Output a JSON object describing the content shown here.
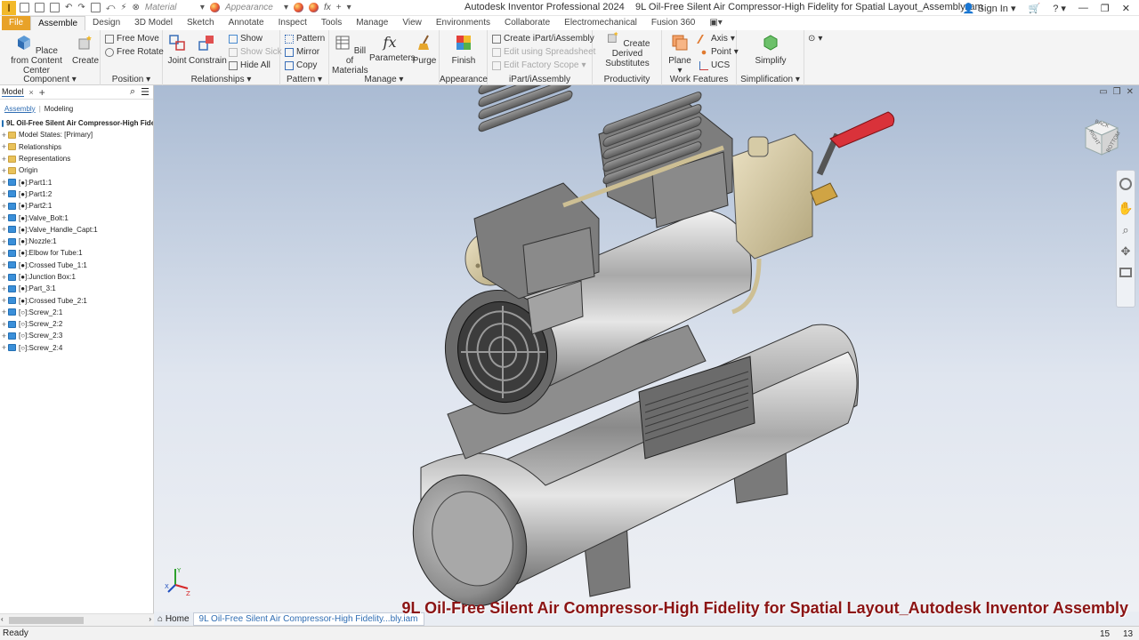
{
  "window": {
    "app_name": "Autodesk Inventor Professional 2024",
    "document_title": "9L Oil-Free Silent Air Compressor-High Fidelity for Spatial Layout_Assembly.iam",
    "sign_in": "Sign In",
    "material_label": "Material",
    "appearance_label": "Appearance"
  },
  "tabs": [
    "File",
    "Assemble",
    "Design",
    "3D Model",
    "Sketch",
    "Annotate",
    "Inspect",
    "Tools",
    "Manage",
    "View",
    "Environments",
    "Collaborate",
    "Electromechanical",
    "Fusion 360"
  ],
  "active_tab": "Assemble",
  "ribbon": {
    "component": {
      "title": "Component",
      "place": "Place from Content Center",
      "create": "Create"
    },
    "position": {
      "title": "Position",
      "free_move": "Free Move",
      "free_rotate": "Free Rotate"
    },
    "relationships": {
      "title": "Relationships",
      "joint": "Joint",
      "constrain": "Constrain",
      "show": "Show",
      "show_sick": "Show Sick",
      "hide_all": "Hide All"
    },
    "pattern": {
      "title": "Pattern",
      "pattern": "Pattern",
      "mirror": "Mirror",
      "copy": "Copy"
    },
    "manage": {
      "title": "Manage",
      "bom": "Bill of Materials",
      "parameters": "Parameters",
      "purge": "Purge"
    },
    "appearance": {
      "title": "Appearance",
      "finish": "Finish"
    },
    "ipart": {
      "title": "iPart/iAssembly",
      "create": "Create iPart/iAssembly",
      "edit_spreadsheet": "Edit using Spreadsheet",
      "edit_scope": "Edit Factory Scope"
    },
    "productivity": {
      "title": "Productivity",
      "derived": "Create Derived Substitutes"
    },
    "work_features": {
      "title": "Work Features",
      "plane": "Plane",
      "axis": "Axis",
      "point": "Point",
      "ucs": "UCS"
    },
    "simplification": {
      "title": "Simplification",
      "simplify": "Simplify"
    }
  },
  "browser": {
    "panel_tab": "Model",
    "sub_tabs": [
      "Assembly",
      "Modeling"
    ],
    "items": [
      {
        "label": "9L Oil-Free Silent Air Compressor-High Fide",
        "kind": "root"
      },
      {
        "label": "Model States: [Primary]",
        "kind": "folder"
      },
      {
        "label": "Relationships",
        "kind": "folder"
      },
      {
        "label": "Representations",
        "kind": "folder"
      },
      {
        "label": "Origin",
        "kind": "folder"
      },
      {
        "label": "[●]:Part1:1",
        "kind": "part"
      },
      {
        "label": "[●]:Part1:2",
        "kind": "part"
      },
      {
        "label": "[●]:Part2:1",
        "kind": "part"
      },
      {
        "label": "[●]:Valve_Bolt:1",
        "kind": "part"
      },
      {
        "label": "[●]:Valve_Handle_Capt:1",
        "kind": "part"
      },
      {
        "label": "[●]:Nozzle:1",
        "kind": "part"
      },
      {
        "label": "[●]:Elbow for Tube:1",
        "kind": "part"
      },
      {
        "label": "[●]:Crossed Tube_1:1",
        "kind": "part"
      },
      {
        "label": "[●]:Junction Box:1",
        "kind": "part"
      },
      {
        "label": "[●]:Part_3:1",
        "kind": "part"
      },
      {
        "label": "[●]:Crossed Tube_2:1",
        "kind": "part"
      },
      {
        "label": "[○]:Screw_2:1",
        "kind": "part"
      },
      {
        "label": "[○]:Screw_2:2",
        "kind": "part"
      },
      {
        "label": "[○]:Screw_2:3",
        "kind": "part"
      },
      {
        "label": "[○]:Screw_2:4",
        "kind": "part"
      }
    ]
  },
  "doc_tabs": {
    "home": "Home",
    "active": "9L Oil-Free Silent Air Compressor-High Fidelity...bly.iam"
  },
  "overlay_caption": "9L Oil-Free Silent Air Compressor-High Fidelity for Spatial Layout_Autodesk Inventor Assembly",
  "status": {
    "text": "Ready",
    "num1": "15",
    "num2": "13"
  },
  "viewcube": {
    "faces": [
      "BACK",
      "RIGHT",
      "BOTTOM"
    ]
  }
}
